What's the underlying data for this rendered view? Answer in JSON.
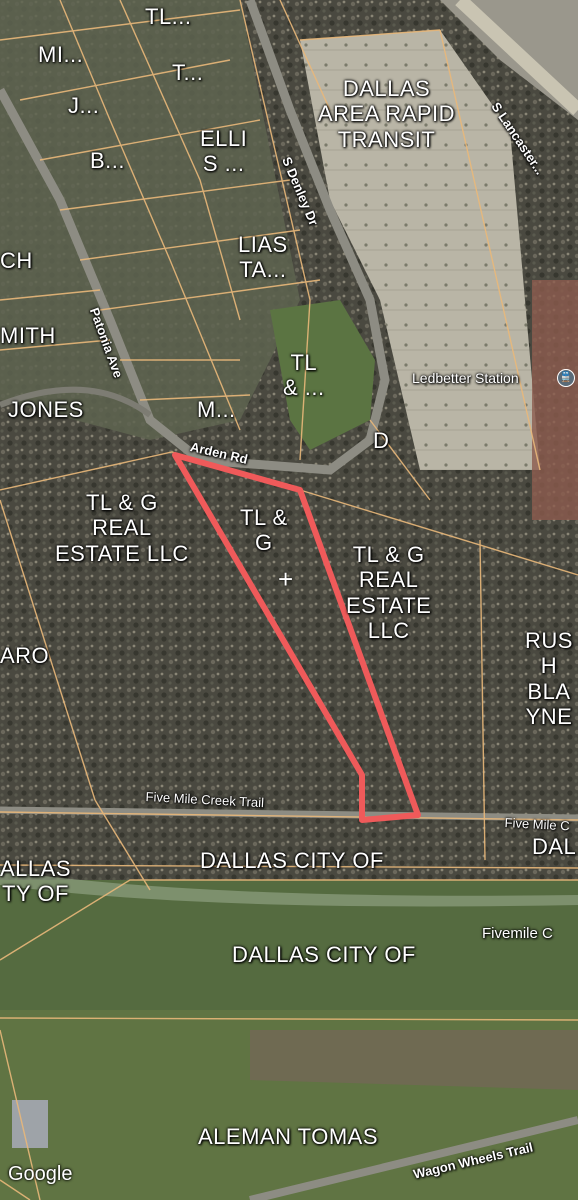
{
  "map": {
    "attribution": "Google",
    "parcels": [
      {
        "id": "tl-top",
        "text": "TL..."
      },
      {
        "id": "mi",
        "text": "MI..."
      },
      {
        "id": "t",
        "text": "T..."
      },
      {
        "id": "j",
        "text": "J..."
      },
      {
        "id": "ellis",
        "text": "ELLI\nS ..."
      },
      {
        "id": "b",
        "text": "B..."
      },
      {
        "id": "dart",
        "text": "DALLAS\nAREA RAPID\nTRANSIT"
      },
      {
        "id": "lias",
        "text": "LIAS\nTA..."
      },
      {
        "id": "ch",
        "text": "CH"
      },
      {
        "id": "mith",
        "text": "MITH"
      },
      {
        "id": "tl-amp",
        "text": "TL\n& ..."
      },
      {
        "id": "jones",
        "text": "JONES"
      },
      {
        "id": "m",
        "text": "M..."
      },
      {
        "id": "d",
        "text": "D"
      },
      {
        "id": "tlg-left",
        "text": "TL & G\nREAL\nESTATE LLC"
      },
      {
        "id": "tlg-selected",
        "text": "TL &\nG"
      },
      {
        "id": "tlg-right",
        "text": "TL & G\nREAL\nESTATE\nLLC"
      },
      {
        "id": "aro",
        "text": "ARO"
      },
      {
        "id": "rush",
        "text": "RUS\nH\nBLA\nYNE"
      },
      {
        "id": "dallas-left",
        "text": "ALLAS\nTY OF"
      },
      {
        "id": "dallas-city-1",
        "text": "DALLAS CITY OF"
      },
      {
        "id": "dal-right",
        "text": "DAL"
      },
      {
        "id": "dallas-city-2",
        "text": "DALLAS CITY OF"
      },
      {
        "id": "aleman",
        "text": "ALEMAN TOMAS"
      }
    ],
    "roads": [
      {
        "id": "s-lancaster",
        "text": "S Lancaster..."
      },
      {
        "id": "s-denley",
        "text": "S Denley Dr"
      },
      {
        "id": "patonia",
        "text": "Patonia Ave"
      },
      {
        "id": "arden",
        "text": "Arden Rd"
      },
      {
        "id": "five-mile-trail",
        "text": "Five Mile Creek Trail"
      },
      {
        "id": "five-mile-c",
        "text": "Five Mile C"
      },
      {
        "id": "fivemile-c",
        "text": "Fivemile C"
      },
      {
        "id": "wagon-wheels",
        "text": "Wagon Wheels Trail"
      }
    ],
    "poi": {
      "name": "Ledbetter Station",
      "icon": "train-icon"
    },
    "colors": {
      "parcel_line": "#e9b87a",
      "selection": "#ef5a5a",
      "trees": "#4b4a40",
      "grass": "#5d7048",
      "road": "#8b8a80",
      "lot": "#b8b4a5"
    }
  }
}
